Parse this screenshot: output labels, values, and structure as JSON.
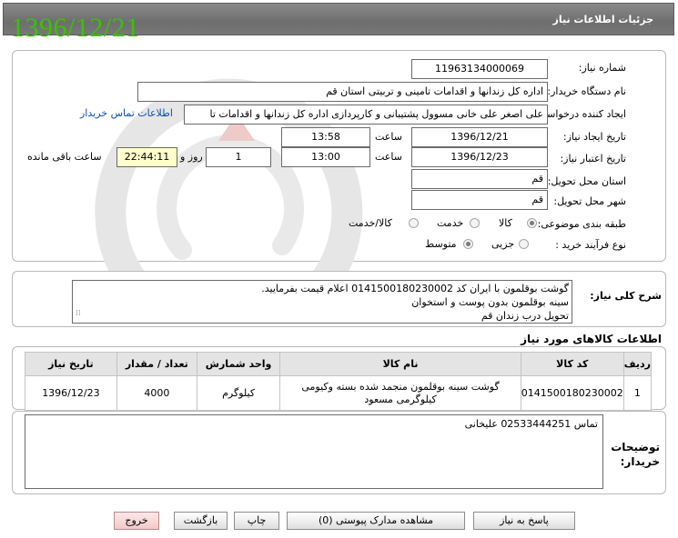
{
  "header": {
    "title": "جزئیات اطلاعات نیاز",
    "date_stamp": "1396/12/21"
  },
  "form": {
    "need_number": {
      "label": "شماره نیاز:",
      "value": "11963134000069"
    },
    "buyer_org": {
      "label": "نام دستگاه خریدار:",
      "value": "اداره کل زندانها و اقدامات تامینی و تربیتی استان قم"
    },
    "requester": {
      "label": "ایجاد کننده درخواست:",
      "value": "علی اصغر علی خانی مسوول پشتیبانی و کارپردازی اداره کل زندانها و اقدامات تا",
      "contact_link": "اطلاعات تماس خریدار"
    },
    "created": {
      "label": "تاریخ ایجاد نیاز:",
      "date": "1396/12/21",
      "time_label": "ساعت",
      "time": "13:58"
    },
    "deadline": {
      "label": "تاریخ اعتبار نیاز:",
      "date": "1396/12/23",
      "time_label": "ساعت",
      "time": "13:00",
      "days": "1",
      "days_label": "روز و",
      "remaining": "22:44:11",
      "remaining_label": "ساعت باقی مانده"
    },
    "province": {
      "label": "استان محل تحویل:",
      "value": "قم"
    },
    "city": {
      "label": "شهر محل تحویل:",
      "value": "قم"
    },
    "category": {
      "label": "طبقه بندی موضوعی:",
      "options": [
        "کالا",
        "خدمت",
        "کالا/خدمت"
      ],
      "selected": "کالا"
    },
    "purchase_type": {
      "label": "نوع فرآیند خرید :",
      "options": [
        "جزیی",
        "متوسط"
      ],
      "selected": "متوسط"
    }
  },
  "description": {
    "label": "شرح کلی نیاز:",
    "lines": [
      "گوشت بوقلمون با ایران کد 0141500180230002 اعلام قیمت بفرمایید.",
      "سینه بوقلمون بدون پوست و استخوان",
      "تحویل درب زندان قم"
    ]
  },
  "items_section": {
    "title": "اطلاعات کالاهای مورد نیاز",
    "columns": [
      "ردیف",
      "کد کالا",
      "نام کالا",
      "واحد شمارش",
      "تعداد / مقدار",
      "تاریخ نیاز"
    ],
    "rows": [
      {
        "row": "1",
        "code": "0141500180230002",
        "name_line1": "گوشت سینه بوقلمون منجمد شده بسته وکیومی",
        "name_line2": "کیلوگرمی مسعود",
        "unit": "کیلوگرم",
        "qty": "4000",
        "date": "1396/12/23"
      }
    ]
  },
  "notes": {
    "label": "توضیحات خریدار:",
    "value": "تماس 02533444251 علیخانی"
  },
  "buttons": {
    "reply": "پاسخ به نیاز",
    "attachments": "مشاهده مدارک پیوستی (0)",
    "print": "چاپ",
    "back": "بازگشت",
    "exit": "خروج"
  },
  "colors": {
    "header_bg": "#777777",
    "date_stamp": "#38c400",
    "link": "#0a4fb3",
    "remaining_bg": "#ffffcc"
  }
}
